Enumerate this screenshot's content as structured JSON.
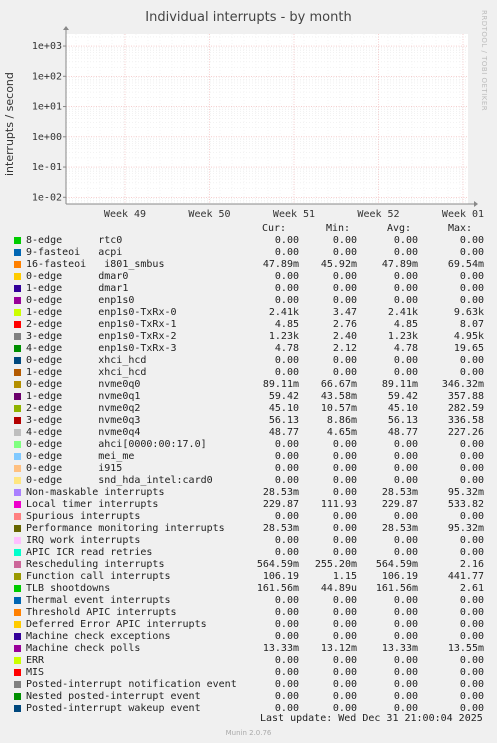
{
  "title": "Individual interrupts - by month",
  "side_credit": "RRDTOOL / TOBI OETIKER",
  "footer": {
    "last_update": "Last update:  Wed Dec 31 21:00:04 2025",
    "munin": "Munin 2.0.76"
  },
  "columns": [
    "Cur:",
    "Min:",
    "Avg:",
    "Max:"
  ],
  "chart_data": {
    "type": "line",
    "title": "Individual interrupts - by month",
    "ylabel": "interrupts / second",
    "xlabel": "",
    "y_scale": "log",
    "ylim": [
      0.006,
      2500
    ],
    "y_ticks": [
      "1e+03",
      "1e+02",
      "1e+01",
      "1e+00",
      "1e-01",
      "1e-02"
    ],
    "x_ticks": [
      "Week 49",
      "Week 50",
      "Week 51",
      "Week 52",
      "Week 01"
    ],
    "grid": true,
    "legend_position": "bottom",
    "series": [
      {
        "name": "8-edge      rtc0",
        "color": "#00cc00",
        "cur": "0.00",
        "min": "0.00",
        "avg": "0.00",
        "max": "0.00"
      },
      {
        "name": "9-fasteoi   acpi",
        "color": "#0066b3",
        "cur": "0.00",
        "min": "0.00",
        "avg": "0.00",
        "max": "0.00"
      },
      {
        "name": "16-fasteoi   i801_smbus",
        "color": "#ff8000",
        "cur": "47.89m",
        "min": "45.92m",
        "avg": "47.89m",
        "max": "69.54m"
      },
      {
        "name": "0-edge      dmar0",
        "color": "#ffcc00",
        "cur": "0.00",
        "min": "0.00",
        "avg": "0.00",
        "max": "0.00"
      },
      {
        "name": "1-edge      dmar1",
        "color": "#330099",
        "cur": "0.00",
        "min": "0.00",
        "avg": "0.00",
        "max": "0.00"
      },
      {
        "name": "0-edge      enp1s0",
        "color": "#990099",
        "cur": "0.00",
        "min": "0.00",
        "avg": "0.00",
        "max": "0.00"
      },
      {
        "name": "1-edge      enp1s0-TxRx-0",
        "color": "#ccff00",
        "cur": "2.41k",
        "min": "3.47",
        "avg": "2.41k",
        "max": "9.63k"
      },
      {
        "name": "2-edge      enp1s0-TxRx-1",
        "color": "#ff0000",
        "cur": "4.85",
        "min": "2.76",
        "avg": "4.85",
        "max": "8.07"
      },
      {
        "name": "3-edge      enp1s0-TxRx-2",
        "color": "#808080",
        "cur": "1.23k",
        "min": "2.40",
        "avg": "1.23k",
        "max": "4.95k"
      },
      {
        "name": "4-edge      enp1s0-TxRx-3",
        "color": "#008f00",
        "cur": "4.78",
        "min": "2.12",
        "avg": "4.78",
        "max": "19.65"
      },
      {
        "name": "0-edge      xhci_hcd",
        "color": "#00487d",
        "cur": "0.00",
        "min": "0.00",
        "avg": "0.00",
        "max": "0.00"
      },
      {
        "name": "1-edge      xhci_hcd",
        "color": "#b35a00",
        "cur": "0.00",
        "min": "0.00",
        "avg": "0.00",
        "max": "0.00"
      },
      {
        "name": "0-edge      nvme0q0",
        "color": "#b38f00",
        "cur": "89.11m",
        "min": "66.67m",
        "avg": "89.11m",
        "max": "346.32m"
      },
      {
        "name": "1-edge      nvme0q1",
        "color": "#6b006b",
        "cur": "59.42",
        "min": "43.58m",
        "avg": "59.42",
        "max": "357.88"
      },
      {
        "name": "2-edge      nvme0q2",
        "color": "#8fb300",
        "cur": "45.10",
        "min": "10.57m",
        "avg": "45.10",
        "max": "282.59"
      },
      {
        "name": "3-edge      nvme0q3",
        "color": "#b30000",
        "cur": "56.13",
        "min": "8.86m",
        "avg": "56.13",
        "max": "336.58"
      },
      {
        "name": "4-edge      nvme0q4",
        "color": "#bebebe",
        "cur": "48.77",
        "min": "4.65m",
        "avg": "48.77",
        "max": "227.26"
      },
      {
        "name": "0-edge      ahci[0000:00:17.0]",
        "color": "#80ff80",
        "cur": "0.00",
        "min": "0.00",
        "avg": "0.00",
        "max": "0.00"
      },
      {
        "name": "0-edge      mei_me",
        "color": "#80c9ff",
        "cur": "0.00",
        "min": "0.00",
        "avg": "0.00",
        "max": "0.00"
      },
      {
        "name": "0-edge      i915",
        "color": "#ffc080",
        "cur": "0.00",
        "min": "0.00",
        "avg": "0.00",
        "max": "0.00"
      },
      {
        "name": "0-edge      snd_hda_intel:card0",
        "color": "#ffe680",
        "cur": "0.00",
        "min": "0.00",
        "avg": "0.00",
        "max": "0.00"
      },
      {
        "name": "Non-maskable interrupts",
        "color": "#aa80ff",
        "cur": "28.53m",
        "min": "0.00",
        "avg": "28.53m",
        "max": "95.32m"
      },
      {
        "name": "Local timer interrupts",
        "color": "#ee00cc",
        "cur": "229.87",
        "min": "111.93",
        "avg": "229.87",
        "max": "533.82"
      },
      {
        "name": "Spurious interrupts",
        "color": "#ff8080",
        "cur": "0.00",
        "min": "0.00",
        "avg": "0.00",
        "max": "0.00"
      },
      {
        "name": "Performance monitoring interrupts",
        "color": "#666600",
        "cur": "28.53m",
        "min": "0.00",
        "avg": "28.53m",
        "max": "95.32m"
      },
      {
        "name": "IRQ work interrupts",
        "color": "#ffbfff",
        "cur": "0.00",
        "min": "0.00",
        "avg": "0.00",
        "max": "0.00"
      },
      {
        "name": "APIC ICR read retries",
        "color": "#00ffcc",
        "cur": "0.00",
        "min": "0.00",
        "avg": "0.00",
        "max": "0.00"
      },
      {
        "name": "Rescheduling interrupts",
        "color": "#cc6699",
        "cur": "564.59m",
        "min": "255.20m",
        "avg": "564.59m",
        "max": "2.16"
      },
      {
        "name": "Function call interrupts",
        "color": "#999900",
        "cur": "106.19",
        "min": "1.15",
        "avg": "106.19",
        "max": "441.77"
      },
      {
        "name": "TLB shootdowns",
        "color": "#00cc00",
        "cur": "161.56m",
        "min": "44.89u",
        "avg": "161.56m",
        "max": "2.61"
      },
      {
        "name": "Thermal event interrupts",
        "color": "#0066b3",
        "cur": "0.00",
        "min": "0.00",
        "avg": "0.00",
        "max": "0.00"
      },
      {
        "name": "Threshold APIC interrupts",
        "color": "#ff8000",
        "cur": "0.00",
        "min": "0.00",
        "avg": "0.00",
        "max": "0.00"
      },
      {
        "name": "Deferred Error APIC interrupts",
        "color": "#ffcc00",
        "cur": "0.00",
        "min": "0.00",
        "avg": "0.00",
        "max": "0.00"
      },
      {
        "name": "Machine check exceptions",
        "color": "#330099",
        "cur": "0.00",
        "min": "0.00",
        "avg": "0.00",
        "max": "0.00"
      },
      {
        "name": "Machine check polls",
        "color": "#990099",
        "cur": "13.33m",
        "min": "13.12m",
        "avg": "13.33m",
        "max": "13.55m"
      },
      {
        "name": "ERR",
        "color": "#ccff00",
        "cur": "0.00",
        "min": "0.00",
        "avg": "0.00",
        "max": "0.00"
      },
      {
        "name": "MIS",
        "color": "#ff0000",
        "cur": "0.00",
        "min": "0.00",
        "avg": "0.00",
        "max": "0.00"
      },
      {
        "name": "Posted-interrupt notification event",
        "color": "#808080",
        "cur": "0.00",
        "min": "0.00",
        "avg": "0.00",
        "max": "0.00"
      },
      {
        "name": "Nested posted-interrupt event",
        "color": "#008f00",
        "cur": "0.00",
        "min": "0.00",
        "avg": "0.00",
        "max": "0.00"
      },
      {
        "name": "Posted-interrupt wakeup event",
        "color": "#00487d",
        "cur": "0.00",
        "min": "0.00",
        "avg": "0.00",
        "max": "0.00"
      }
    ]
  }
}
